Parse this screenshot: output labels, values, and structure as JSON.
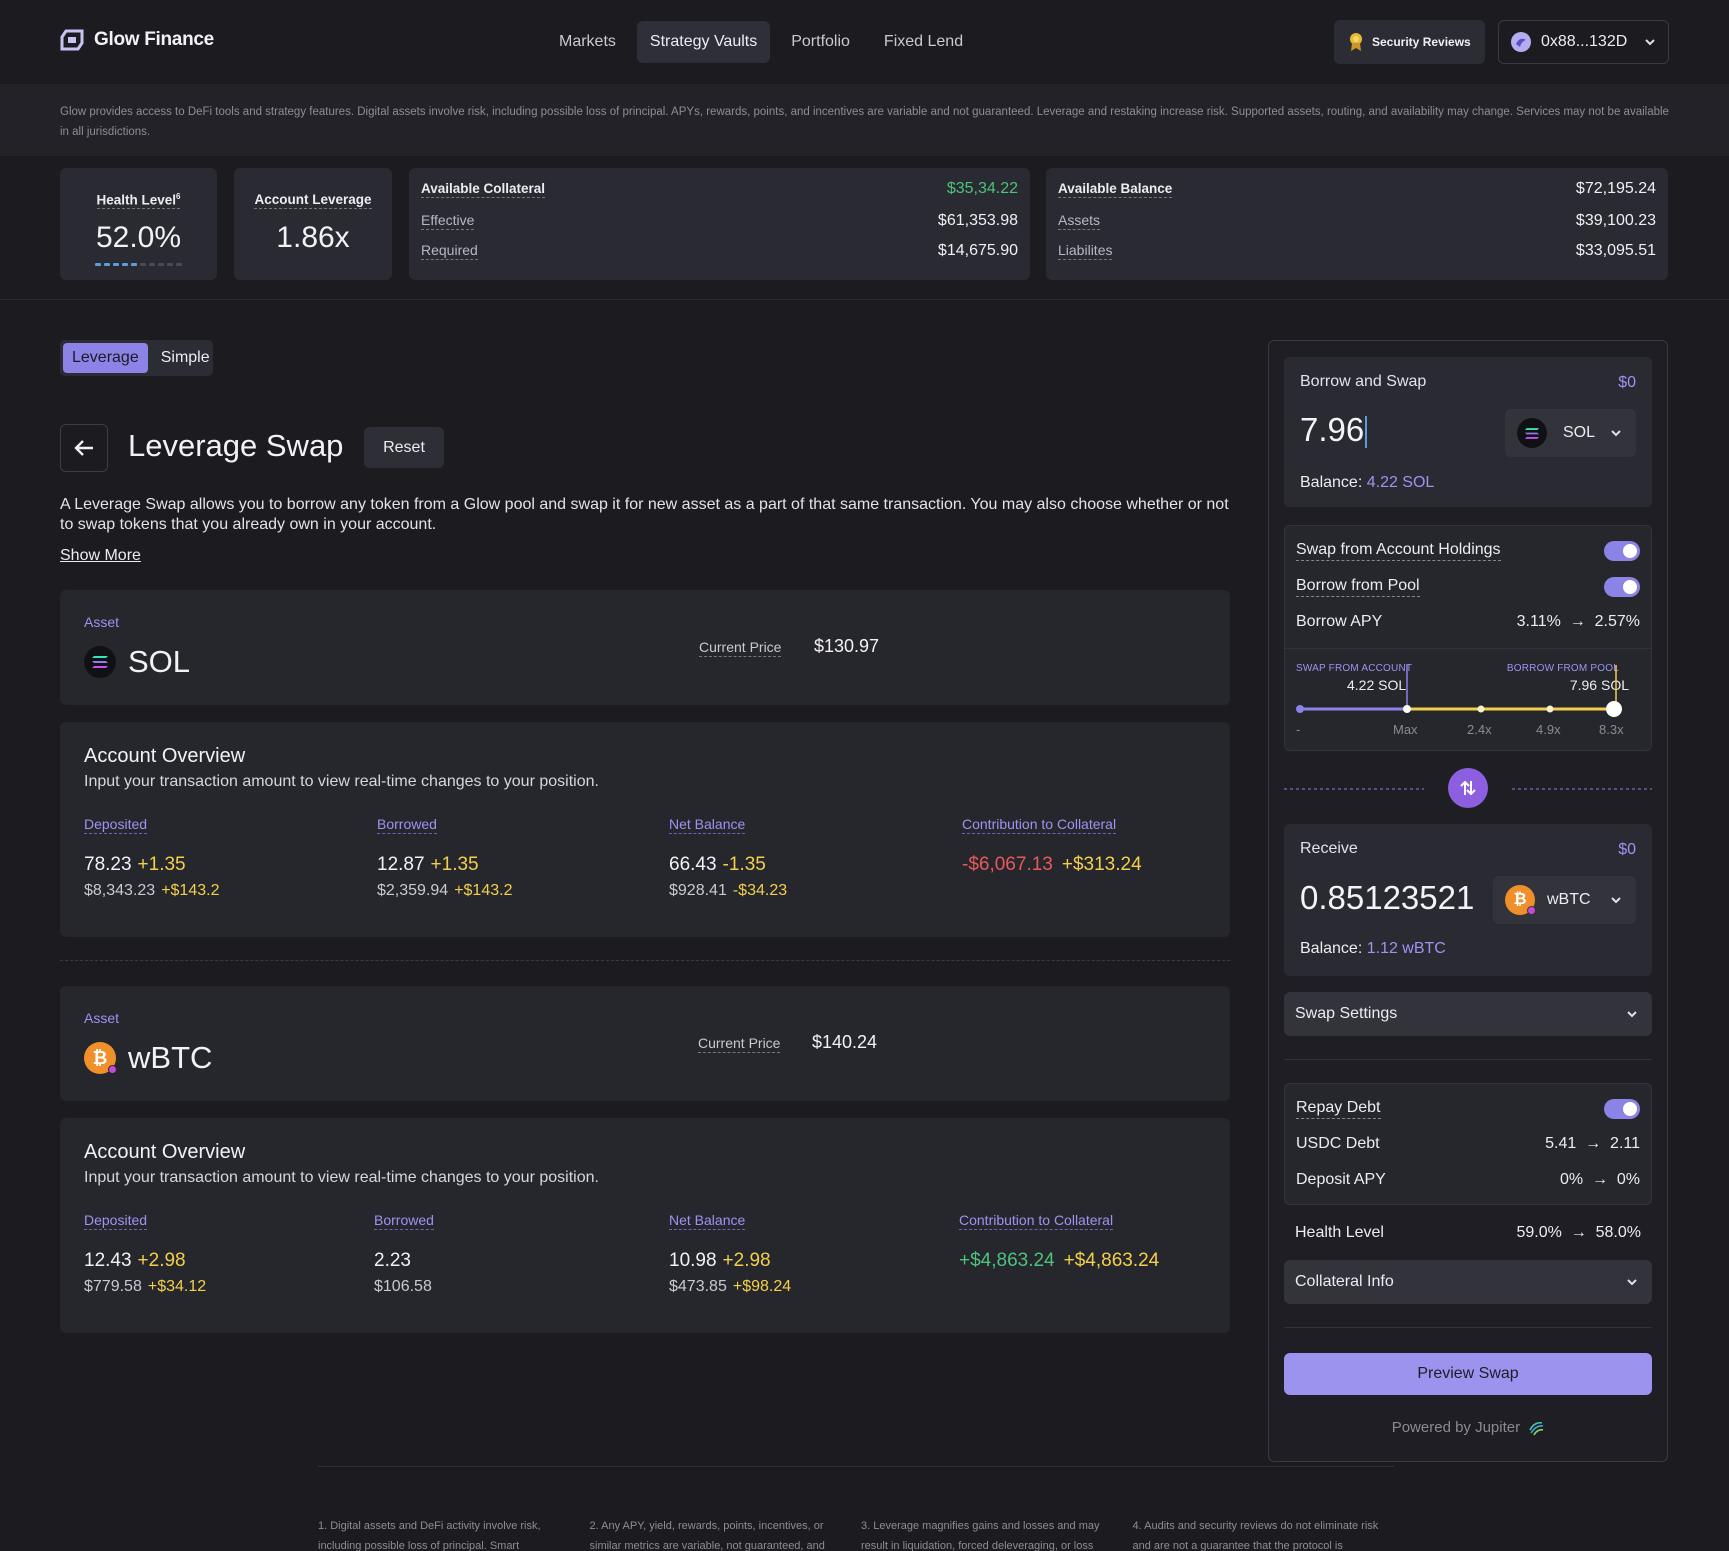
{
  "app": {
    "name": "Glow Finance"
  },
  "nav": {
    "items": [
      "Markets",
      "Strategy Vaults",
      "Portfolio",
      "Fixed Lend"
    ],
    "active": "Strategy Vaults"
  },
  "header": {
    "security_label": "Security Reviews",
    "wallet": "0x88...132D"
  },
  "disclaimer": "Glow provides access to DeFi tools and strategy features. Digital assets involve risk, including possible loss of principal. APYs, rewards, points, and incentives are variable and not guaranteed. Leverage and restaking increase risk. Supported assets, routing, and availability may change. Services may not be available in all jurisdictions.",
  "stats": {
    "health": {
      "title": "Health Level",
      "sup": "6",
      "value": "52.0%",
      "level": 0.52
    },
    "leverage": {
      "title": "Account Leverage",
      "value": "1.86x"
    },
    "collateral": {
      "title": "Available Collateral",
      "value": "$35,34.22",
      "effective_label": "Effective",
      "effective": "$61,353.98",
      "required_label": "Required",
      "required": "$14,675.90"
    },
    "balance": {
      "title": "Available Balance",
      "value": "$72,195.24",
      "assets_label": "Assets",
      "assets": "$39,100.23",
      "liab_label": "Liabilites",
      "liab": "$33,095.51"
    }
  },
  "mode": {
    "leverage": "Leverage",
    "simple": "Simple",
    "active": "Leverage"
  },
  "page": {
    "title": "Leverage Swap",
    "reset": "Reset",
    "description": "A Leverage Swap allows you to borrow any token from a Glow pool and swap it for new asset as a part of that same transaction. You may also choose whether or not to swap tokens that you already own in your account.",
    "show_more": "Show More"
  },
  "asset1": {
    "label": "Asset",
    "name": "SOL",
    "price_label": "Current Price",
    "price": "$130.97"
  },
  "overview1": {
    "title": "Account Overview",
    "subtitle": "Input your transaction amount to view real-time changes to your position.",
    "cols": [
      {
        "label": "Deposited",
        "main": "78.23",
        "main_delta": "+1.35",
        "sub": "$8,343.23",
        "sub_delta": "+$143.2"
      },
      {
        "label": "Borrowed",
        "main": "12.87",
        "main_delta": "+1.35",
        "sub": "$2,359.94",
        "sub_delta": "+$143.2"
      },
      {
        "label": "Net Balance",
        "main": "66.43",
        "main_delta": "-1.35",
        "sub": "$928.41",
        "sub_delta": "-$34.23"
      },
      {
        "label": "Contribution to Collateral",
        "main": "-$6,067.13",
        "main_delta": "+$313.24"
      }
    ]
  },
  "asset2": {
    "label": "Asset",
    "name": "wBTC",
    "price_label": "Current Price",
    "price": "$140.24"
  },
  "overview2": {
    "title": "Account Overview",
    "subtitle": "Input your transaction amount to view real-time changes to your position.",
    "cols": [
      {
        "label": "Deposited",
        "main": "12.43",
        "main_delta": "+2.98",
        "sub": "$779.58",
        "sub_delta": "+$34.12"
      },
      {
        "label": "Borrowed",
        "main": "2.23",
        "sub": "$106.58"
      },
      {
        "label": "Net Balance",
        "main": "10.98",
        "main_delta": "+2.98",
        "sub": "$473.85",
        "sub_delta": "+$98.24"
      },
      {
        "label": "Contribution to Collateral",
        "main": "+$4,863.24",
        "main_delta": "+$4,863.24"
      }
    ]
  },
  "swap": {
    "borrow": {
      "title": "Borrow and Swap",
      "usd": "$0",
      "amount": "7.96",
      "token": "SOL",
      "balance_label": "Balance:",
      "balance": "4.22 SOL"
    },
    "options": {
      "swap_holdings": "Swap from Account Holdings",
      "borrow_pool": "Borrow from Pool",
      "apy_label": "Borrow APY",
      "apy_from": "3.11%",
      "apy_to": "2.57%",
      "slider": {
        "left_label": "SWAP FROM ACCOUNT",
        "left_value": "4.22 SOL",
        "right_label": "BORROW FROM POOL",
        "right_value": "7.96 SOL",
        "ticks": [
          "-",
          "Max",
          "2.4x",
          "4.9x",
          "8.3x"
        ]
      }
    },
    "receive": {
      "title": "Receive",
      "usd": "$0",
      "amount": "0.85123521",
      "token": "wBTC",
      "balance_label": "Balance:",
      "balance": "1.12 wBTC"
    },
    "settings_label": "Swap Settings",
    "repay": {
      "label": "Repay Debt",
      "usdc_label": "USDC Debt",
      "usdc_from": "5.41",
      "usdc_to": "2.11",
      "dep_label": "Deposit APY",
      "dep_from": "0%",
      "dep_to": "0%"
    },
    "health": {
      "label": "Health Level",
      "from": "59.0%",
      "to": "58.0%"
    },
    "collateral_info": "Collateral Info",
    "preview": "Preview Swap",
    "powered": "Powered by Jupiter"
  },
  "footnotes": [
    "1. Digital assets and DeFi activity involve risk, including possible loss of principal. Smart",
    "2. Any APY, yield, rewards, points, incentives, or similar metrics are variable, not guaranteed, and",
    "3. Leverage magnifies gains and losses and may result in liquidation, forced deleveraging, or loss",
    "4. Audits and security reviews do not eliminate risk and are not a guarantee that the protocol is"
  ],
  "colors": {
    "accent": "#8b83e6",
    "green": "#4cc37a",
    "yellow": "#f2d04a",
    "red": "#e85a5a"
  }
}
